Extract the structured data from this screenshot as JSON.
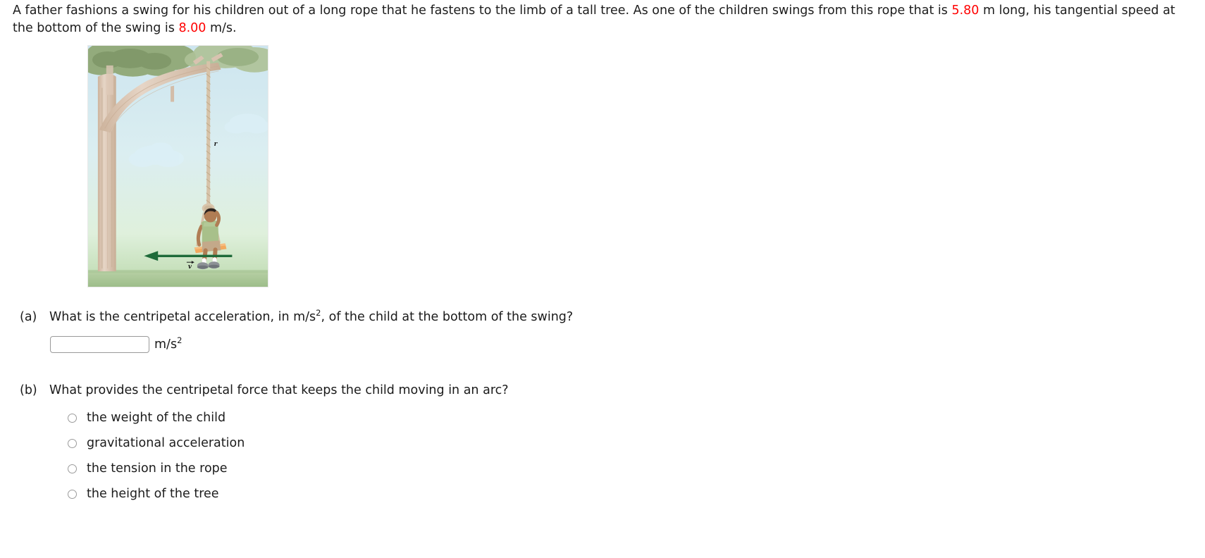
{
  "problem": {
    "text_before_rope": "A father fashions a swing for his children out of a long rope that he fastens to the limb of a tall tree. As one of the children swings from this rope that is ",
    "rope_length": "5.80",
    "text_between": " m long, his tangential speed at the bottom of the swing is ",
    "speed": "8.00",
    "text_after": " m/s."
  },
  "figure": {
    "alt": "swing-diagram",
    "radius_label": "r",
    "velocity_label": "v",
    "colors": {
      "sky_top": "#cfe6ef",
      "sky_bottom": "#dfeeda",
      "ground": "#a9c99a",
      "tree_bark": "#ddc7b5",
      "canopy": "#8fa878",
      "canopy_light": "#b9cba4",
      "rope": "#d8c6ae",
      "seat": "#f2a95e",
      "shirt": "#a8c08a",
      "shorts": "#c3a98a",
      "skin": "#b07d54",
      "hair": "#2c2420",
      "shoe": "#8d9196",
      "arrow": "#1f6b3a",
      "cloud": "#d6ebf5"
    }
  },
  "parts": [
    {
      "label": "(a)",
      "question_before_unit": "What is the centripetal acceleration, in m/s",
      "exponent": "2",
      "question_after_unit": ", of the child at the bottom of the swing?",
      "answer_value": "",
      "answer_placeholder": "",
      "unit_base": "m/s",
      "unit_exponent": "2"
    },
    {
      "label": "(b)",
      "question": "What provides the centripetal force that keeps the child moving in an arc?",
      "options": [
        "the weight of the child",
        "gravitational acceleration",
        "the tension in the rope",
        "the height of the tree"
      ]
    }
  ]
}
